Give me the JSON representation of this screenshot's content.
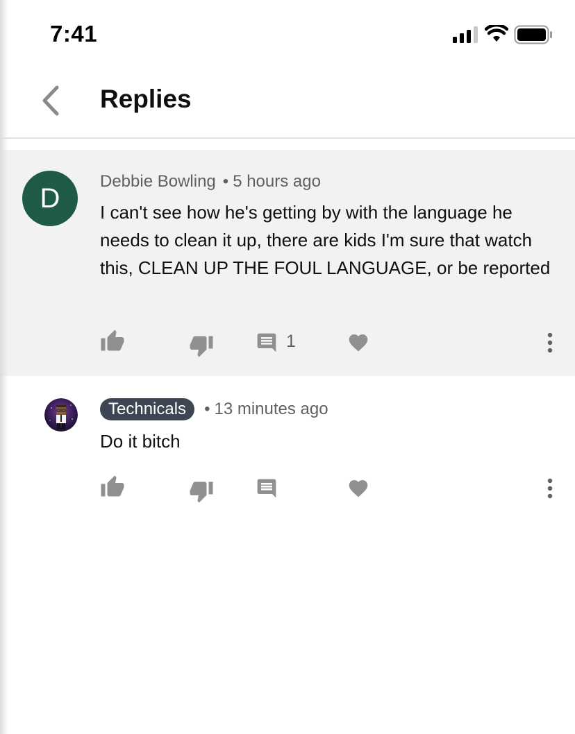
{
  "status_bar": {
    "time": "7:41"
  },
  "header": {
    "title": "Replies"
  },
  "comments": [
    {
      "avatar_letter": "D",
      "author": "Debbie Bowling",
      "separator": "•",
      "time": "5 hours ago",
      "text": "I can't see how he's getting by with the language he needs to clean it up, there are kids I'm sure that watch this, CLEAN UP THE FOUL LANGUAGE, or be reported",
      "reply_count": "1"
    },
    {
      "author": "Technicals",
      "separator": "•",
      "time": "13 minutes ago",
      "text": "Do it bitch"
    }
  ],
  "icons": {
    "back": "chevron-left-icon",
    "like": "thumbs-up-icon",
    "dislike": "thumbs-down-icon",
    "reply": "comment-icon",
    "heart": "heart-icon",
    "more": "more-vertical-icon"
  },
  "colors": {
    "icon_gray": "#909090",
    "avatar_green": "#1e5a45",
    "badge_bg": "#3e4654",
    "parent_bg": "#f2f2f2"
  }
}
